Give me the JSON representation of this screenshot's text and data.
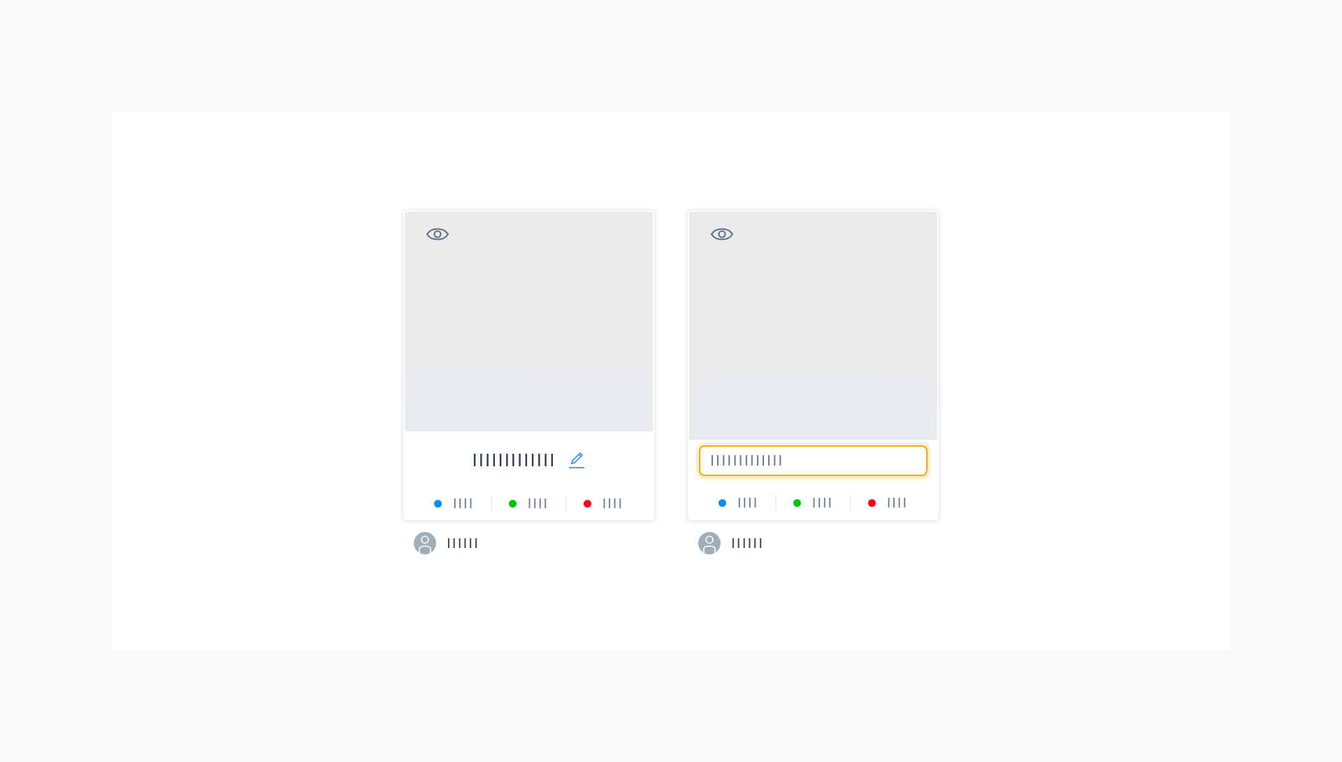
{
  "cards": [
    {
      "kind": "view",
      "title": "IIIIIIIIIIIII",
      "stats": [
        {
          "label": "IIII",
          "color": "#0a8cff"
        },
        {
          "label": "IIII",
          "color": "#00c40a"
        },
        {
          "label": "IIII",
          "color": "#ff0019"
        }
      ],
      "author": "IIIIII"
    },
    {
      "kind": "edit",
      "title": "IIIIIIIIIIIII",
      "stats": [
        {
          "label": "IIII",
          "color": "#0a8cff"
        },
        {
          "label": "IIII",
          "color": "#00c40a"
        },
        {
          "label": "IIII",
          "color": "#ff0019"
        }
      ],
      "author": "IIIIII"
    }
  ]
}
